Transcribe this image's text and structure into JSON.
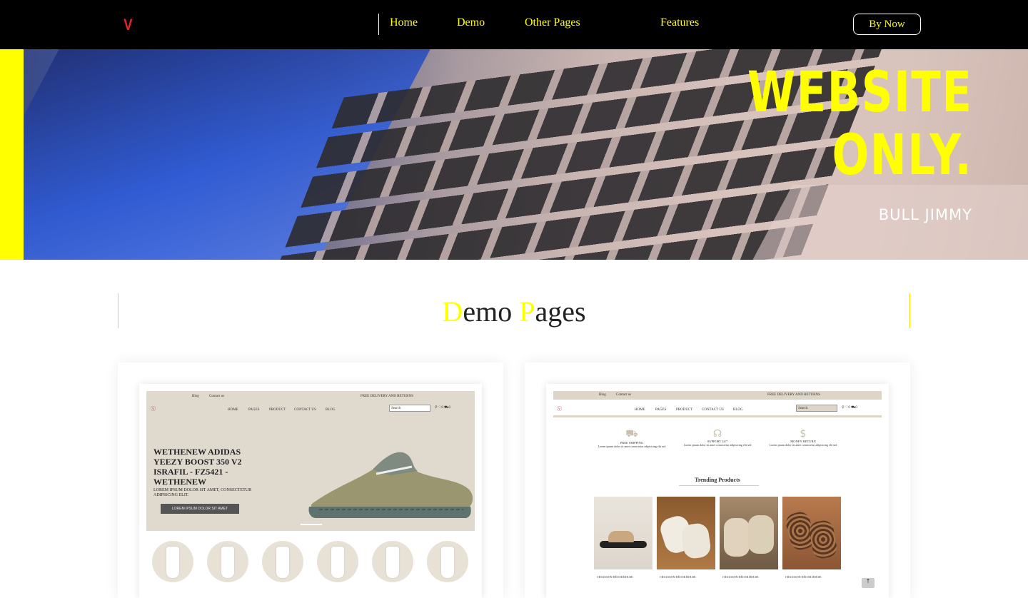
{
  "header": {
    "logo": "V",
    "nav": [
      "Home",
      "Demo",
      "Other Pages",
      "Features"
    ],
    "buy_button": "By Now"
  },
  "hero": {
    "line1": "WEBSITE",
    "line2": "ONLY.",
    "author": "BULL JIMMY",
    "accent_color": "#ffff00"
  },
  "section": {
    "title_first_initial": "D",
    "title_first_rest": "emo",
    "title_second_initial": "P",
    "title_second_rest": "ages"
  },
  "demo1": {
    "topbar_links": [
      "Blog",
      "Contact us"
    ],
    "topbar_promo": "FREE DELIVERY AND RETURNS",
    "menu": [
      "HOME",
      "PAGES",
      "PRODUCT",
      "CONTACT US",
      "BLOG"
    ],
    "search_placeholder": "Search",
    "cart_wishlist": "0",
    "cart_count": "0",
    "product_title": "WETHENEW ADIDAS YEEZY BOOST 350 V2 ISRAFIL - FZ5421 - WETHENEW",
    "product_desc": "LOREM IPSUM DOLOR SIT AMET, CONSECTETUR ADIPISCING ELIT.",
    "cta": "LOREM IPSUM DOLOR SIT AMET"
  },
  "demo2": {
    "topbar_links": [
      "Blog",
      "Contact us"
    ],
    "topbar_promo": "FREE DELIVERY AND RETURNS",
    "menu": [
      "HOME",
      "PAGES",
      "PRODUCT",
      "CONTACT US",
      "BLOG"
    ],
    "search_placeholder": "Search",
    "features": [
      {
        "title": "FREE SHIPPING",
        "desc": "Lorem ipsum dolor sit amet consectetur adipisicing elit sed",
        "icon": "truck-icon"
      },
      {
        "title": "SUPPORT 24/7",
        "desc": "Lorem ipsum dolor sit amet consectetur adipisicing elit sed",
        "icon": "headset-icon"
      },
      {
        "title": "MONEY RETURN",
        "desc": "Lorem ipsum dolor sit amet consectetur adipisicing elit sed",
        "icon": "dollar-icon"
      }
    ],
    "trending_title": "Trending Products",
    "product_captions": [
      "CHAUSSON DÉCOR HOUSE",
      "CHAUSSON DÉCOR HOUSE",
      "CHAUSSON DÉCOR HOUSE",
      "CHAUSSON DÉCOR HOUSE"
    ]
  }
}
